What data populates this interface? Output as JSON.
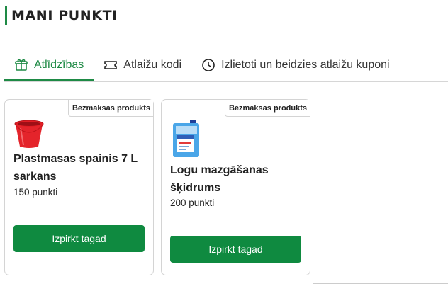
{
  "page": {
    "title": "MANI PUNKTI"
  },
  "tabs": [
    {
      "label": "Atlīdzības",
      "icon": "gift-icon",
      "active": true
    },
    {
      "label": "Atlaižu kodi",
      "icon": "ticket-icon",
      "active": false
    },
    {
      "label": "Izlietoti un beidzies atlaižu kuponi",
      "icon": "clock-icon",
      "active": false
    }
  ],
  "products": [
    {
      "badge": "Bezmaksas produkts",
      "image": "red-bucket",
      "name": "Plastmasas spainis 7 L sarkans",
      "points": "150 punkti",
      "button": "Izpirkt tagad"
    },
    {
      "badge": "Bezmaksas produkts",
      "image": "washer-fluid-canister",
      "name": "Logu mazgāšanas šķidrums",
      "points": "200 punkti",
      "button": "Izpirkt tagad"
    }
  ],
  "colors": {
    "accent": "#1e8a45",
    "button": "#0f8a40"
  }
}
